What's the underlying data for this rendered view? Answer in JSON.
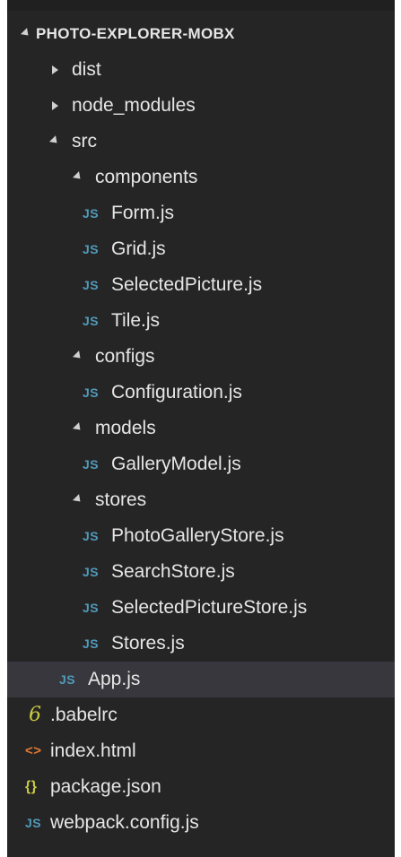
{
  "explorer": {
    "root_label": "PHOTO-EXPLORER-MOBX",
    "items": [
      {
        "label": "dist",
        "kind": "folder-collapsed"
      },
      {
        "label": "node_modules",
        "kind": "folder-collapsed"
      },
      {
        "label": "src",
        "kind": "folder-expanded"
      },
      {
        "label": "components",
        "kind": "folder-expanded"
      },
      {
        "label": "Form.js",
        "kind": "js-file",
        "icon_text": "JS"
      },
      {
        "label": "Grid.js",
        "kind": "js-file",
        "icon_text": "JS"
      },
      {
        "label": "SelectedPicture.js",
        "kind": "js-file",
        "icon_text": "JS"
      },
      {
        "label": "Tile.js",
        "kind": "js-file",
        "icon_text": "JS"
      },
      {
        "label": "configs",
        "kind": "folder-expanded"
      },
      {
        "label": "Configuration.js",
        "kind": "js-file",
        "icon_text": "JS"
      },
      {
        "label": "models",
        "kind": "folder-expanded"
      },
      {
        "label": "GalleryModel.js",
        "kind": "js-file",
        "icon_text": "JS"
      },
      {
        "label": "stores",
        "kind": "folder-expanded"
      },
      {
        "label": "PhotoGalleryStore.js",
        "kind": "js-file",
        "icon_text": "JS"
      },
      {
        "label": "SearchStore.js",
        "kind": "js-file",
        "icon_text": "JS"
      },
      {
        "label": "SelectedPictureStore.js",
        "kind": "js-file",
        "icon_text": "JS"
      },
      {
        "label": "Stores.js",
        "kind": "js-file",
        "icon_text": "JS"
      },
      {
        "label": "App.js",
        "kind": "js-file",
        "icon_text": "JS",
        "selected": true
      },
      {
        "label": ".babelrc",
        "kind": "babel-file",
        "icon_text": "6"
      },
      {
        "label": "index.html",
        "kind": "html-file",
        "icon_text": "<>"
      },
      {
        "label": "package.json",
        "kind": "json-file",
        "icon_text": "{}"
      },
      {
        "label": "webpack.config.js",
        "kind": "js-file",
        "icon_text": "JS"
      }
    ]
  },
  "colors": {
    "background": "#252526",
    "selected_row": "#37373d",
    "js_icon": "#519aba",
    "babel_icon": "#cbcb41",
    "html_icon": "#e37933",
    "json_icon": "#cbcb41"
  }
}
